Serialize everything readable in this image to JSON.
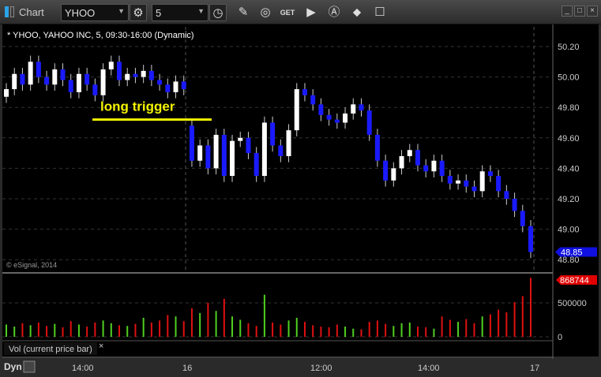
{
  "window": {
    "title": "Chart",
    "symbol": "YHOO",
    "interval": "5",
    "close_buttons": [
      "_",
      "□",
      "×"
    ]
  },
  "toolbar_icons": [
    "settings-gear-icon",
    "clock-icon",
    "pencil-icon",
    "study-icon",
    "get-icon",
    "play-icon",
    "alert-icon",
    "link-icon",
    "comment-icon"
  ],
  "chart": {
    "header": "* YHOO, YAHOO INC, 5, 09:30-16:00 (Dynamic)",
    "copyright": "© eSignal, 2014",
    "annotation": "long trigger",
    "annotation_color": "#f5f500",
    "price_axis": [
      "50.20",
      "50.00",
      "49.80",
      "49.60",
      "49.40",
      "49.20",
      "49.00",
      "48.80"
    ],
    "last_price": "48.85",
    "last_price_color": "#1010e0",
    "up_color": "#ffffff",
    "down_color": "#1a1aff",
    "closes": [
      49.92,
      50.02,
      49.95,
      50.1,
      50.0,
      49.95,
      50.05,
      49.98,
      49.9,
      50.02,
      49.95,
      49.88,
      50.05,
      50.1,
      49.98,
      50.02,
      50.0,
      50.04,
      49.98,
      49.95,
      49.9,
      49.97,
      49.92,
      49.45,
      49.55,
      49.4,
      49.62,
      49.35,
      49.58,
      49.6,
      49.5,
      49.35,
      49.7,
      49.55,
      49.48,
      49.65,
      49.92,
      49.88,
      49.82,
      49.75,
      49.72,
      49.7,
      49.76,
      49.82,
      49.78,
      49.62,
      49.45,
      49.32,
      49.4,
      49.48,
      49.52,
      49.42,
      49.38,
      49.45,
      49.35,
      49.3,
      49.32,
      49.28,
      49.25,
      49.38,
      49.35,
      49.25,
      49.2,
      49.12,
      49.02,
      48.85
    ],
    "trigger_price": 49.72
  },
  "volume": {
    "label": "Vol (current price bar)",
    "axis": [
      "500000",
      "0"
    ],
    "last_volume": "868744",
    "last_volume_color": "#e00000",
    "values": [
      180000,
      150000,
      200000,
      170000,
      210000,
      160000,
      190000,
      140000,
      230000,
      180000,
      150000,
      210000,
      240000,
      200000,
      170000,
      160000,
      190000,
      280000,
      210000,
      240000,
      320000,
      300000,
      230000,
      420000,
      350000,
      500000,
      380000,
      560000,
      300000,
      250000,
      200000,
      160000,
      620000,
      210000,
      180000,
      240000,
      280000,
      220000,
      170000,
      150000,
      140000,
      180000,
      150000,
      120000,
      110000,
      220000,
      240000,
      190000,
      160000,
      200000,
      210000,
      150000,
      140000,
      120000,
      300000,
      250000,
      220000,
      260000,
      200000,
      300000,
      330000,
      400000,
      360000,
      510000,
      600000,
      868744
    ]
  },
  "time_axis": [
    "14:00",
    "16",
    "12:00",
    "14:00",
    "17"
  ],
  "bottom": {
    "mode": "Dyn"
  }
}
